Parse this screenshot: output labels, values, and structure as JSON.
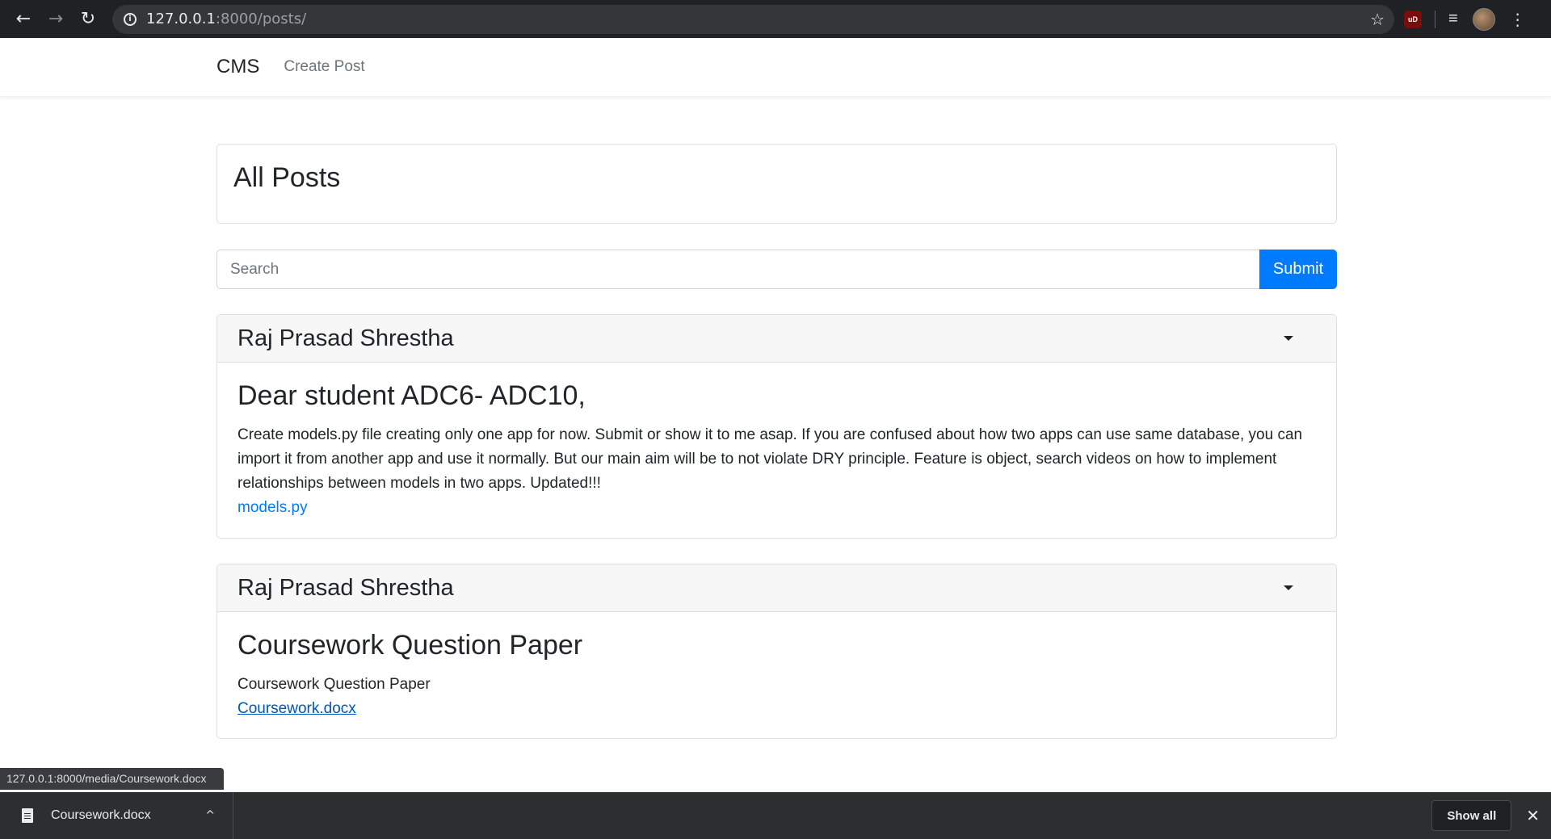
{
  "browser": {
    "url_host": "127.0.0.1",
    "url_path": ":8000/posts/",
    "back_glyph": "←",
    "forward_glyph": "→",
    "reload_glyph": "↻",
    "info_glyph": "i",
    "star_glyph": "☆",
    "ext_label": "uD",
    "media_glyph": "≡",
    "menu_glyph": "⋮"
  },
  "navbar": {
    "brand": "CMS",
    "links": [
      "Create Post"
    ]
  },
  "page": {
    "title": "All Posts"
  },
  "search": {
    "placeholder": "Search",
    "value": "",
    "submit_label": "Submit"
  },
  "posts": [
    {
      "author": "Raj Prasad Shrestha",
      "title": "Dear student ADC6- ADC10,",
      "body": "Create models.py file creating only one app for now. Submit or show it to me asap. If you are confused about how two apps can use same database, you can import it from another app and use it normally. But our main aim will be to not violate DRY principle. Feature is object, search videos on how to implement relationships between models in two apps. Updated!!!",
      "attachment": "models.py"
    },
    {
      "author": "Raj Prasad Shrestha",
      "title": "Coursework Question Paper",
      "body": "Coursework Question Paper",
      "attachment": "Coursework.docx"
    }
  ],
  "status_bar": {
    "url": "127.0.0.1:8000/media/Coursework.docx"
  },
  "downloads": {
    "file_name": "Coursework.docx",
    "chevron_glyph": "^",
    "show_all_label": "Show all",
    "close_glyph": "✕"
  },
  "colors": {
    "accent": "#007bff",
    "link_visited": "#0056b3",
    "chrome_dark": "#202124"
  }
}
